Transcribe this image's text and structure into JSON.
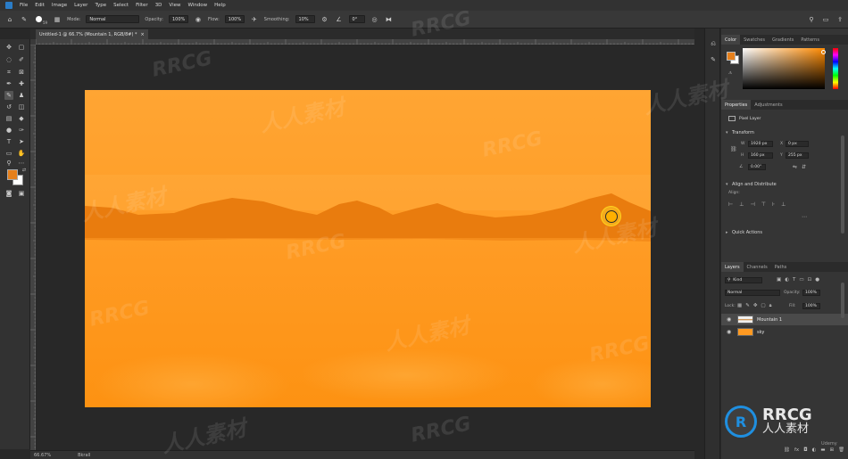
{
  "menu": [
    "File",
    "Edit",
    "Image",
    "Layer",
    "Type",
    "Select",
    "Filter",
    "3D",
    "View",
    "Window",
    "Help"
  ],
  "options": {
    "mode_label": "Mode:",
    "mode_value": "Normal",
    "opacity_label": "Opacity:",
    "opacity_value": "100%",
    "flow_label": "Flow:",
    "flow_value": "100%",
    "smoothing_label": "Smoothing:",
    "smoothing_value": "10%",
    "angle_value": "0°",
    "brush_size": "59"
  },
  "document_tab": "Untitled-1 @ 66.7% (Mountain 1, RGB/8#) *",
  "status": {
    "zoom": "66.67%",
    "info": "Bkrall"
  },
  "panels": {
    "color_tabs": [
      "Color",
      "Swatches",
      "Gradients",
      "Patterns"
    ],
    "properties_tabs": [
      "Properties",
      "Adjustments"
    ],
    "pixel_layer": "Pixel Layer",
    "transform_title": "Transform",
    "w_label": "W",
    "w_value": "1920 px",
    "h_label": "H",
    "h_value": "160 px",
    "x_label": "X",
    "x_value": "0 px",
    "y_label": "Y",
    "y_value": "255 px",
    "angle_value": "0.00°",
    "align_title": "Align and Distribute",
    "align_label": "Align:",
    "quick_actions_title": "Quick Actions",
    "layers_tabs": [
      "Layers",
      "Channels",
      "Paths"
    ],
    "kind_label": "Kind",
    "blend_mode": "Normal",
    "opacity_label": "Opacity:",
    "opacity_value": "100%",
    "lock_label": "Lock:",
    "fill_label": "Fill:",
    "fill_value": "100%",
    "layers": [
      {
        "name": "Mountain 1",
        "selected": true
      },
      {
        "name": "sky",
        "selected": false
      }
    ]
  },
  "watermark": {
    "brand": "RRCG",
    "cn": "人人素材",
    "logo_main": "RRCG",
    "logo_sub": "人人素材",
    "udemy": "Udemy"
  },
  "colors": {
    "foreground": "#e6801c",
    "background": "#ffffff",
    "canvas_top": "#ffa533",
    "canvas_bottom": "#fd9212",
    "mountain": "#e97c0e",
    "accent_blue": "#1f8fe0"
  },
  "icons": {
    "home": "home-icon",
    "brush": "brush-icon",
    "settings": "gear-icon",
    "eye": "eye-icon"
  }
}
